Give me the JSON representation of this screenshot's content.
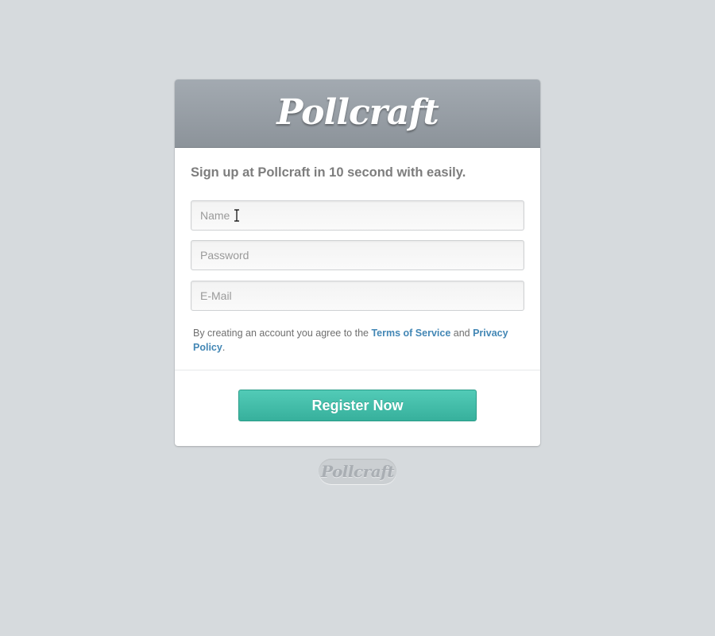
{
  "brand": {
    "name": "Pollcraft",
    "footer_name": "Pollcraft"
  },
  "signup": {
    "intro": "Sign up at Pollcraft in 10 second with easily.",
    "fields": {
      "name_placeholder": "Name",
      "password_placeholder": "Password",
      "email_placeholder": "E-Mail"
    },
    "terms": {
      "prefix": "By creating an account you agree to the ",
      "tos_label": "Terms of Service",
      "middle": " and ",
      "privacy_label": "Privacy Policy",
      "suffix": "."
    },
    "register_label": "Register Now"
  },
  "colors": {
    "page_background": "#d6dadd",
    "header_gradient_top": "#a3aab1",
    "header_gradient_bottom": "#8c939a",
    "link": "#4387b5",
    "button_teal": "#3fbaa5"
  },
  "icons": {
    "text_cursor": "i-beam-cursor-icon"
  }
}
